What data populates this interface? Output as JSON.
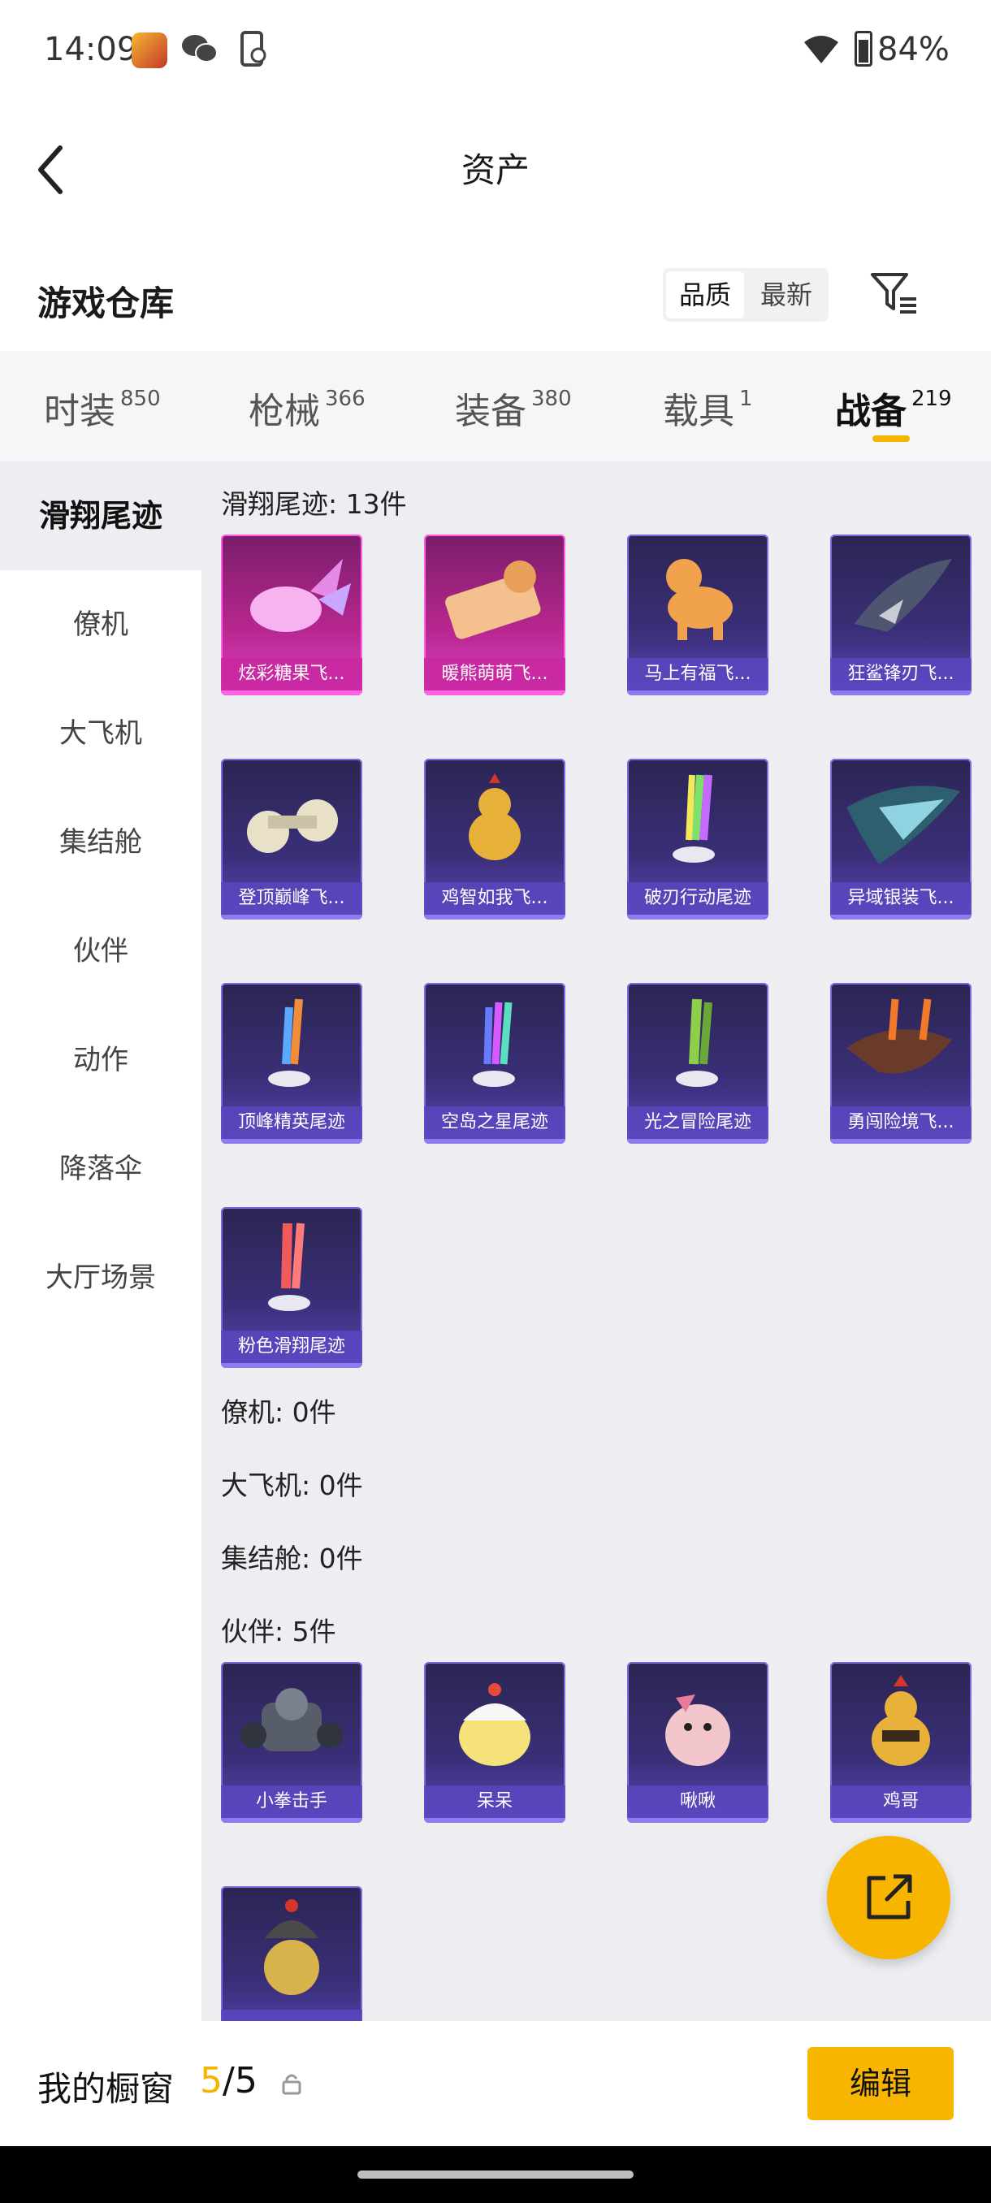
{
  "status_bar": {
    "time": "14:09",
    "battery": "84%"
  },
  "header": {
    "title": "资产"
  },
  "section": {
    "title": "游戏仓库",
    "sort_quality": "品质",
    "sort_newest": "最新"
  },
  "tabs": [
    {
      "label": "时装",
      "count": "850"
    },
    {
      "label": "枪械",
      "count": "366"
    },
    {
      "label": "装备",
      "count": "380"
    },
    {
      "label": "载具",
      "count": "1"
    },
    {
      "label": "战备",
      "count": "219"
    }
  ],
  "sidebar": [
    {
      "label": "滑翔尾迹"
    },
    {
      "label": "僚机"
    },
    {
      "label": "大飞机"
    },
    {
      "label": "集结舱"
    },
    {
      "label": "伙伴"
    },
    {
      "label": "动作"
    },
    {
      "label": "降落伞"
    },
    {
      "label": "大厅场景"
    }
  ],
  "groups": {
    "trails": {
      "label": "滑翔尾迹: 13件",
      "items": [
        {
          "name": "炫彩糖果飞...",
          "rarity": "pink",
          "icon": "candy-icon"
        },
        {
          "name": "暖熊萌萌飞...",
          "rarity": "pink",
          "icon": "bear-bed-icon"
        },
        {
          "name": "马上有福飞...",
          "rarity": "purple",
          "icon": "horse-icon"
        },
        {
          "name": "狂鲨锋刃飞...",
          "rarity": "purple",
          "icon": "shark-icon"
        },
        {
          "name": "登顶巅峰飞...",
          "rarity": "purple",
          "icon": "goggles-icon"
        },
        {
          "name": "鸡智如我飞...",
          "rarity": "purple",
          "icon": "chicken-icon"
        },
        {
          "name": "破刃行动尾迹",
          "rarity": "purple",
          "icon": "rainbow-trail-icon"
        },
        {
          "name": "异域银装飞...",
          "rarity": "purple",
          "icon": "dragon-wing-icon"
        },
        {
          "name": "顶峰精英尾迹",
          "rarity": "purple",
          "icon": "blue-orange-trail-icon"
        },
        {
          "name": "空岛之星尾迹",
          "rarity": "purple",
          "icon": "multi-trail-icon"
        },
        {
          "name": "光之冒险尾迹",
          "rarity": "purple",
          "icon": "green-trail-icon"
        },
        {
          "name": "勇闯险境飞...",
          "rarity": "purple",
          "icon": "bird-fire-icon"
        },
        {
          "name": "粉色滑翔尾迹",
          "rarity": "purple",
          "icon": "pink-trail-icon"
        }
      ]
    },
    "wingman": {
      "label": "僚机: 0件"
    },
    "plane": {
      "label": "大飞机: 0件"
    },
    "pod": {
      "label": "集结舱: 0件"
    },
    "partner": {
      "label": "伙伴: 5件",
      "items": [
        {
          "name": "小拳击手",
          "rarity": "purple",
          "icon": "robot-boxer-icon"
        },
        {
          "name": "呆呆",
          "rarity": "purple",
          "icon": "egg-chick-icon"
        },
        {
          "name": "啾啾",
          "rarity": "purple",
          "icon": "pink-bird-icon"
        },
        {
          "name": "鸡哥",
          "rarity": "purple",
          "icon": "rooster-icon"
        },
        {
          "name": "",
          "rarity": "purple",
          "icon": "helmet-chick-icon"
        }
      ]
    }
  },
  "bottom": {
    "label": "我的橱窗",
    "count_current": "5",
    "count_total": "/5",
    "edit_label": "编辑"
  },
  "colors": {
    "accent": "#f7b500",
    "pink_card": "#c8289a",
    "purple_card": "#3a2f78"
  }
}
